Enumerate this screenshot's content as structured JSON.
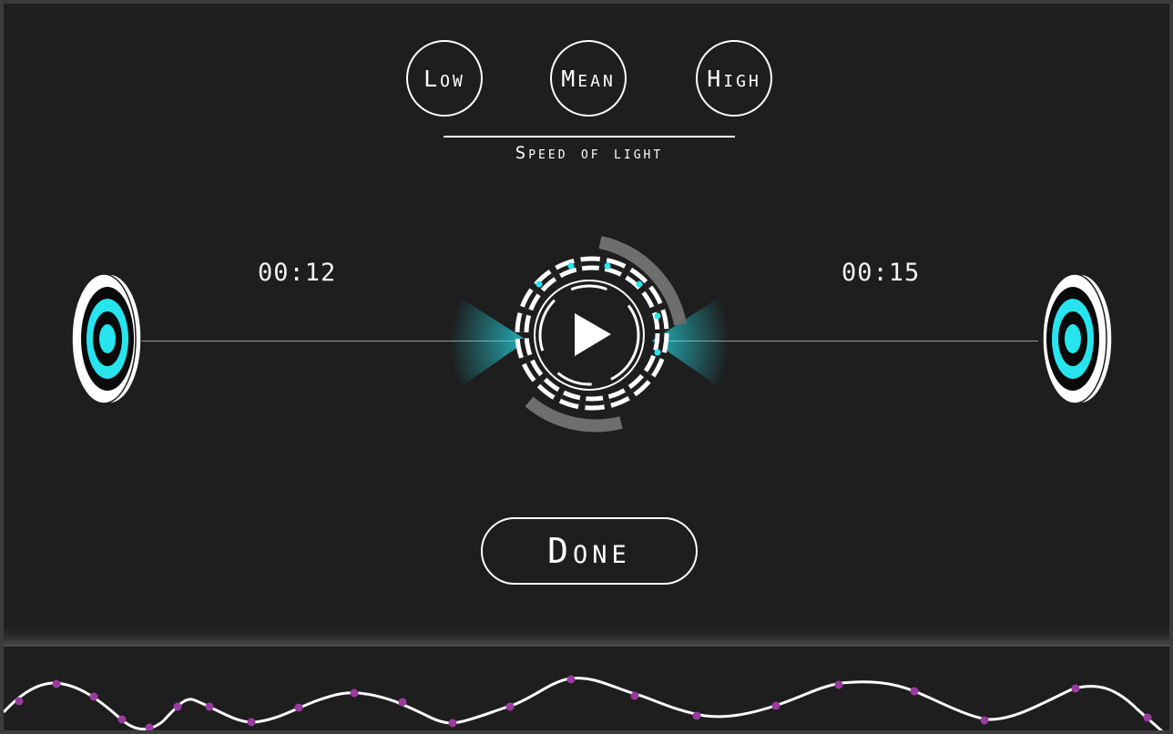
{
  "speed": {
    "options": [
      {
        "label": "Low"
      },
      {
        "label": "Mean"
      },
      {
        "label": "High"
      }
    ],
    "caption": "Speed of light"
  },
  "timeline": {
    "left_time": "00:12",
    "right_time": "00:15"
  },
  "actions": {
    "done_label": "Done"
  },
  "icons": {
    "play": "play-icon",
    "targets": "target-icon"
  },
  "colors": {
    "background": "#1e1e1e",
    "accent_cyan": "#27e4ee",
    "wave_dot": "#9a3b9f",
    "foreground": "#ffffff"
  }
}
